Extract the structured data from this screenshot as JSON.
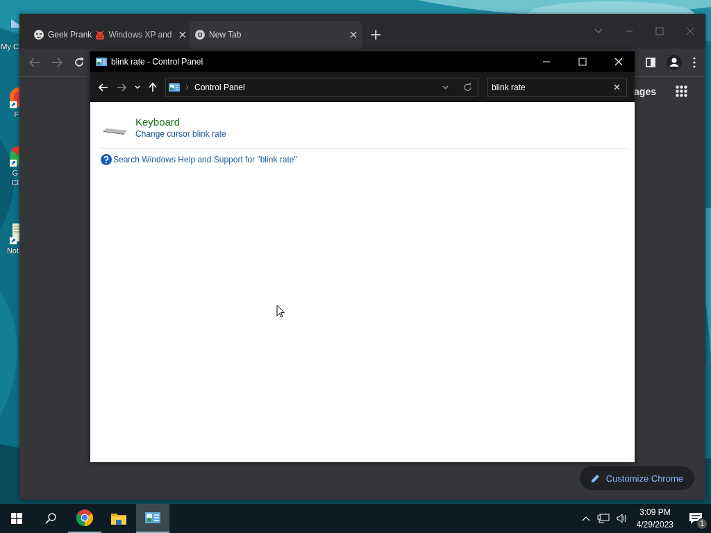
{
  "desktop": {
    "icons": [
      {
        "kind": "pc",
        "label_lines": [
          "My C"
        ]
      },
      {
        "kind": "orange-globe",
        "label_lines": [
          "F"
        ]
      },
      {
        "kind": "color-globe",
        "label_lines": [
          "G",
          "Cl"
        ]
      },
      {
        "kind": "notepad",
        "label_lines": [
          "Not"
        ]
      }
    ]
  },
  "browser": {
    "tabs": [
      {
        "kind": "prank",
        "title_start": "Geek Prank",
        "title_end": "Windows XP and",
        "selected": false
      },
      {
        "kind": "newtab",
        "title_start": "New Tab",
        "selected": true
      }
    ],
    "new_tab_button": "+",
    "page": {
      "header_link": "ages",
      "customize_button": "Customize Chrome"
    }
  },
  "control_panel": {
    "title": "blink rate - Control Panel",
    "breadcrumb": "Control Panel",
    "search": {
      "value": "blink rate"
    },
    "results": [
      {
        "title": "Keyboard",
        "link": "Change cursor blink rate"
      }
    ],
    "help_link": "Search Windows Help and Support for \"blink rate\""
  },
  "taskbar": {
    "apps": [
      {
        "kind": "browser",
        "running": true,
        "active": false
      },
      {
        "kind": "folder",
        "running": false,
        "active": false
      },
      {
        "kind": "control-panel",
        "running": true,
        "active": true
      }
    ],
    "time": "3:09 PM",
    "date": "4/29/2023",
    "notifications": "1"
  }
}
